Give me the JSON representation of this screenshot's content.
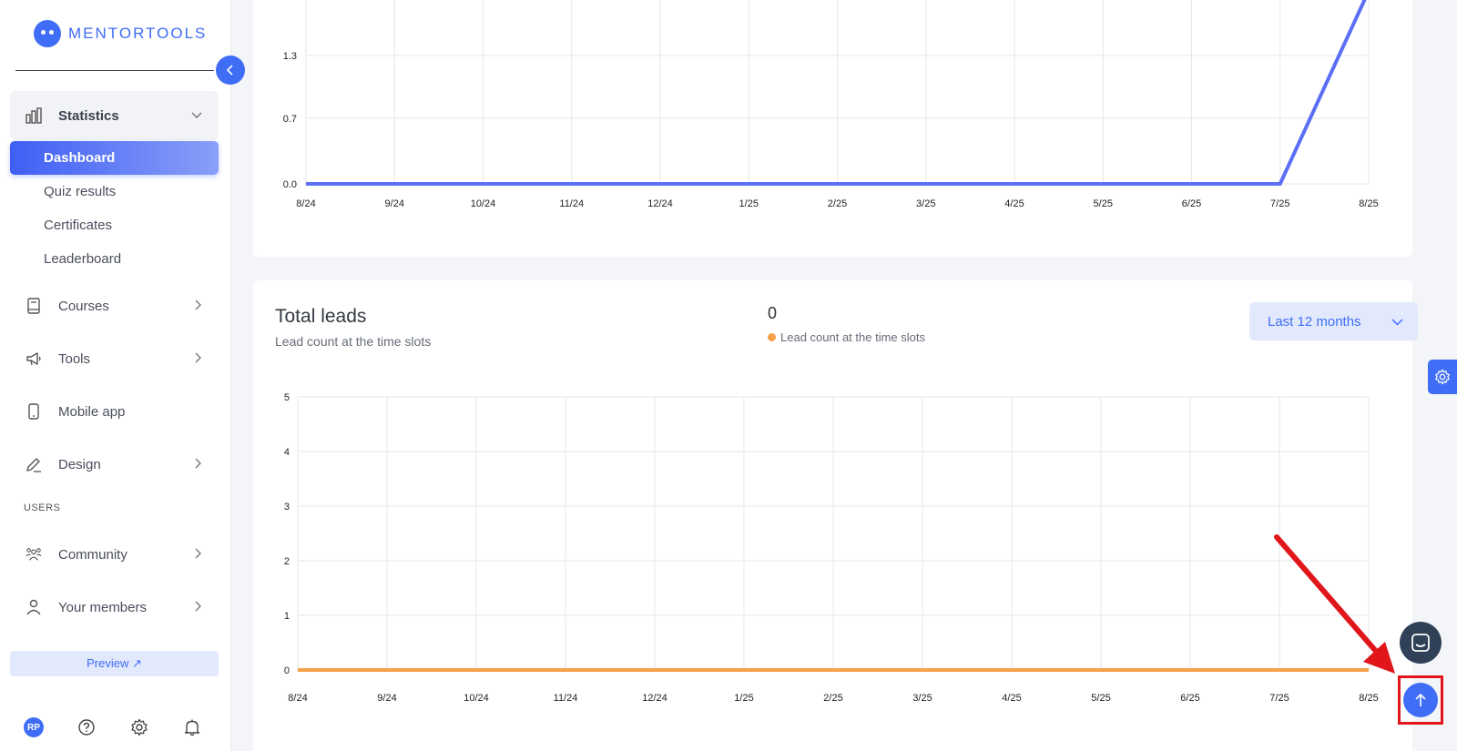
{
  "brand": {
    "name": "MENTORTOOLS"
  },
  "sidebar": {
    "collapse_icon": "chevron-left-icon",
    "statistics": {
      "label": "Statistics",
      "icon": "bar-chart-icon",
      "children": [
        {
          "label": "Dashboard",
          "active": true
        },
        {
          "label": "Quiz results"
        },
        {
          "label": "Certificates"
        },
        {
          "label": "Leaderboard"
        }
      ]
    },
    "items": [
      {
        "label": "Courses",
        "icon": "book-icon",
        "has_children": true
      },
      {
        "label": "Tools",
        "icon": "megaphone-icon",
        "has_children": true
      },
      {
        "label": "Mobile app",
        "icon": "mobile-icon",
        "has_children": false
      },
      {
        "label": "Design",
        "icon": "pencil-icon",
        "has_children": true
      },
      {
        "label": "Community",
        "icon": "group-icon",
        "has_children": true
      },
      {
        "label": "Your members",
        "icon": "user-icon",
        "has_children": true
      }
    ],
    "section_users": "USERS",
    "preview_label": "Preview ↗",
    "footer": {
      "avatar_initials": "RP",
      "icons": [
        "help-icon",
        "gear-icon",
        "bell-icon"
      ]
    }
  },
  "top_chart": {
    "chart_data": {
      "type": "line",
      "categories": [
        "8/24",
        "9/24",
        "10/24",
        "11/24",
        "12/24",
        "1/25",
        "2/25",
        "3/25",
        "4/25",
        "5/25",
        "6/25",
        "7/25",
        "8/25"
      ],
      "y_ticks": [
        "0.0",
        "0.7",
        "1.3"
      ],
      "series": [
        {
          "color": "#5b6ff5",
          "values": [
            0,
            0,
            0,
            0,
            0,
            0,
            0,
            0,
            0,
            0,
            0,
            0,
            2
          ]
        }
      ],
      "grid": true
    }
  },
  "leads": {
    "title": "Total leads",
    "subtitle": "Lead count at the time slots",
    "value": "0",
    "legend_label": "Lead count at the time slots",
    "range_label": "Last 12 months",
    "chart_data": {
      "type": "line",
      "categories": [
        "8/24",
        "9/24",
        "10/24",
        "11/24",
        "12/24",
        "1/25",
        "2/25",
        "3/25",
        "4/25",
        "5/25",
        "6/25",
        "7/25",
        "8/25"
      ],
      "y_ticks": [
        "0",
        "1",
        "2",
        "3",
        "4",
        "5"
      ],
      "ylim": [
        0,
        5
      ],
      "series": [
        {
          "name": "Lead count at the time slots",
          "color": "#f5a04a",
          "values": [
            0,
            0,
            0,
            0,
            0,
            0,
            0,
            0,
            0,
            0,
            0,
            0,
            0
          ]
        }
      ],
      "grid": true
    }
  },
  "floating": {
    "settings_icon": "gear-icon",
    "chat_icon": "chat-icon",
    "scroll_top_icon": "arrow-up-icon"
  },
  "annotation": {
    "color": "#e0161b"
  }
}
